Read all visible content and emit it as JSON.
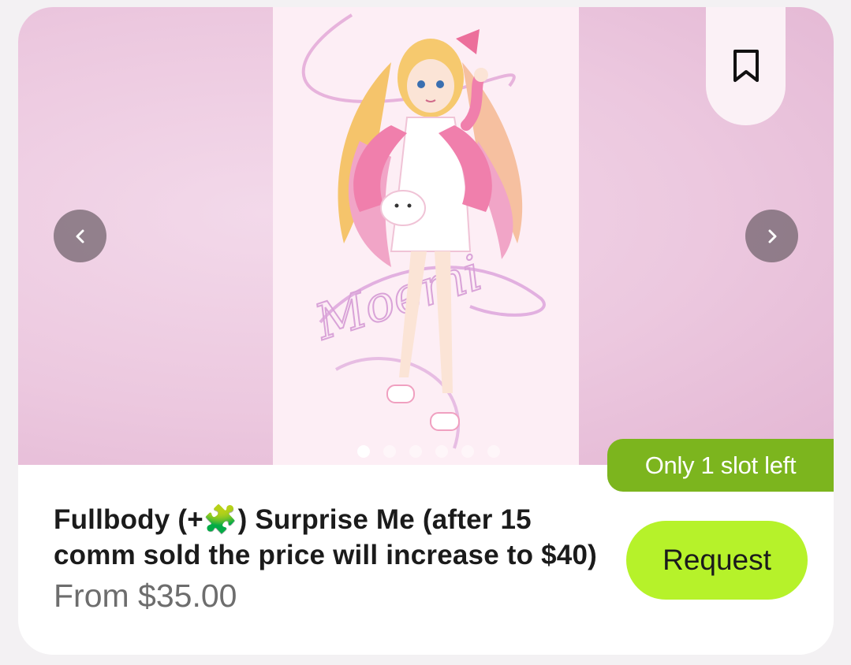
{
  "listing": {
    "title": "Fullbody (+🧩) Surprise Me (after 15 comm sold the price will increase to $40)",
    "price": "From $35.00",
    "slots_badge": "Only 1 slot left",
    "request_label": "Request",
    "artwork_signature": "Moemi"
  },
  "gallery": {
    "image_count": 6,
    "active_index": 0
  },
  "icons": {
    "bookmark": "bookmark-icon",
    "prev": "chevron-left-icon",
    "next": "chevron-right-icon"
  },
  "colors": {
    "card_background": "#ffffff",
    "gallery_background": "#ecc8df",
    "badge_background": "#7cb51e",
    "request_background": "#b6f22a",
    "title_text": "#1b1b1b",
    "price_text": "#6d6d6d"
  }
}
